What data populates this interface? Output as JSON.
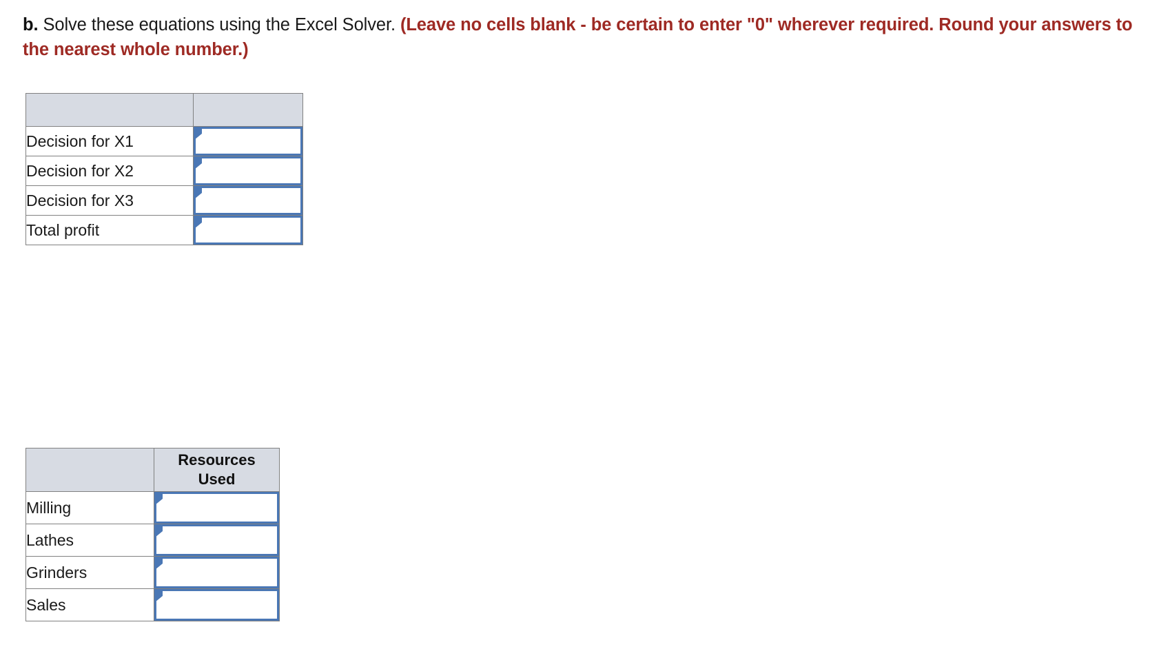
{
  "question": {
    "label": "b.",
    "text": " Solve these equations using the Excel Solver. ",
    "note": "(Leave no cells blank - be certain to enter \"0\" wherever required. Round your answers to the nearest whole number.)"
  },
  "colors": {
    "note_red": "#9e2a24",
    "header_gray": "#d7dbe3",
    "cell_border": "#808080",
    "input_blue": "#4a77b5",
    "text_black": "#1a1a1a"
  },
  "decision_table": {
    "name": "Decision variables and profit",
    "header": {
      "col1": "",
      "col2": ""
    },
    "rows": [
      {
        "label": "Decision for X1",
        "value": "",
        "placeholder": ""
      },
      {
        "label": "Decision for X2",
        "value": "",
        "placeholder": ""
      },
      {
        "label": "Decision for X3",
        "value": "",
        "placeholder": ""
      },
      {
        "label": "Total profit",
        "value": "",
        "placeholder": ""
      }
    ]
  },
  "resources_table": {
    "name": "Resources used",
    "header": {
      "col1": "",
      "col2": "Resources Used"
    },
    "rows": [
      {
        "label": "Milling",
        "value": "",
        "placeholder": ""
      },
      {
        "label": "Lathes",
        "value": "",
        "placeholder": ""
      },
      {
        "label": "Grinders",
        "value": "",
        "placeholder": ""
      },
      {
        "label": "Sales",
        "value": "",
        "placeholder": ""
      }
    ]
  }
}
